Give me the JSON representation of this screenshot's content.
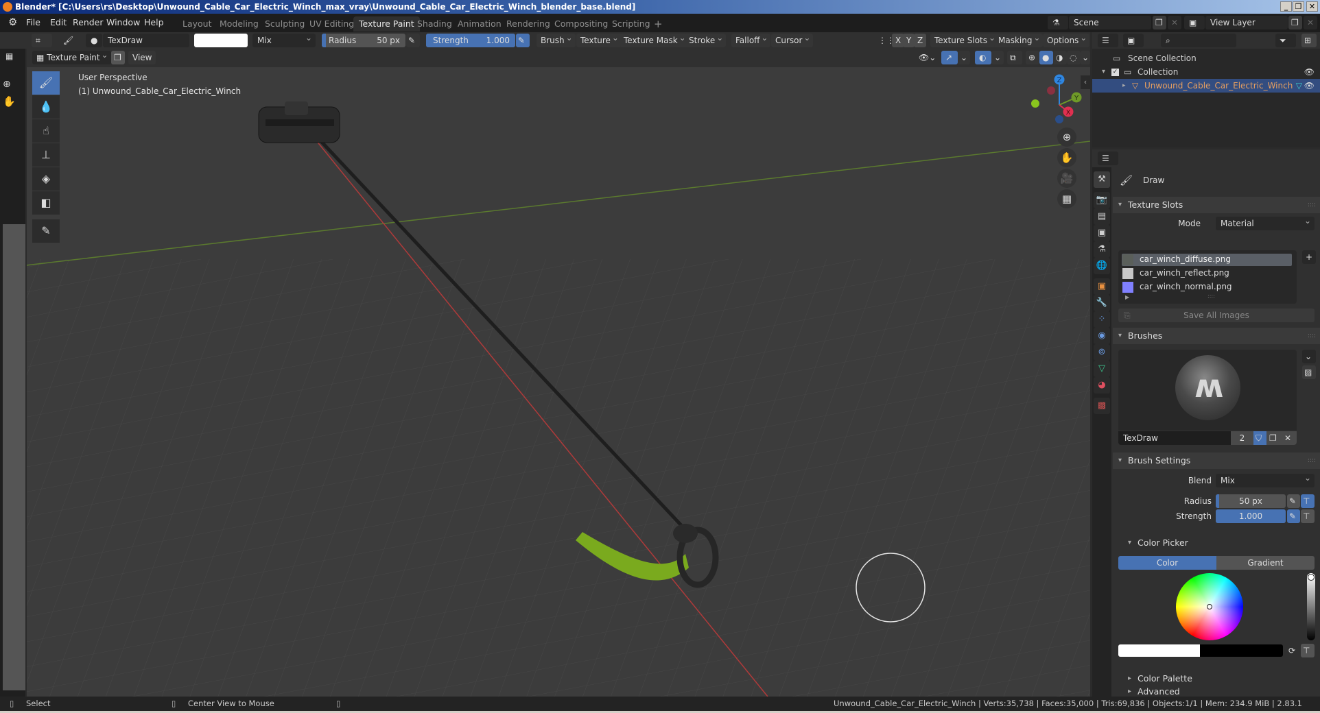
{
  "window": {
    "title": "Blender* [C:\\Users\\rs\\Desktop\\Unwound_Cable_Car_Electric_Winch_max_vray\\Unwound_Cable_Car_Electric_Winch_blender_base.blend]",
    "minimize": "_",
    "maximize": "❐",
    "close": "✕"
  },
  "menubar": {
    "items": [
      "File",
      "Edit",
      "Render",
      "Window",
      "Help"
    ],
    "workspaces": [
      "Layout",
      "Modeling",
      "Sculpting",
      "UV Editing",
      "Texture Paint",
      "Shading",
      "Animation",
      "Rendering",
      "Compositing",
      "Scripting"
    ],
    "active_workspace": "Texture Paint",
    "add_workspace": "+",
    "scene": "Scene",
    "view_layer": "View Layer"
  },
  "toolheader": {
    "brush_name": "TexDraw",
    "color_hex": "#ffffff",
    "blend": "Mix",
    "radius_label": "Radius",
    "radius_value": "50 px",
    "radius_fraction": 0.05,
    "strength_label": "Strength",
    "strength_value": "1.000",
    "strength_fraction": 1.0,
    "menus": [
      "Brush",
      "Texture",
      "Texture Mask",
      "Stroke",
      "Falloff",
      "Cursor"
    ],
    "axes": [
      "X",
      "Y",
      "Z"
    ],
    "right_menus": [
      "Texture Slots",
      "Masking",
      "Options"
    ]
  },
  "viewport_header": {
    "mode": "Texture Paint",
    "view": "View"
  },
  "viewport": {
    "perspective": "User Perspective",
    "object": "(1) Unwound_Cable_Car_Electric_Winch",
    "tools": [
      "draw-brush",
      "soften",
      "smear",
      "clone",
      "fill",
      "mask",
      "annotate"
    ],
    "gizmo": {
      "x": "X",
      "y": "Y",
      "z": "Z"
    }
  },
  "outliner": {
    "scene_collection": "Scene Collection",
    "collection": "Collection",
    "object": "Unwound_Cable_Car_Electric_Winch",
    "accent_object_color": "#e8a060"
  },
  "properties": {
    "tool_name": "Draw",
    "texture_slots": {
      "title": "Texture Slots",
      "mode_label": "Mode",
      "mode_value": "Material",
      "slots": [
        {
          "name": "car_winch_diffuse.png",
          "selected": true,
          "swatch": "#5a5f5a"
        },
        {
          "name": "car_winch_reflect.png",
          "selected": false,
          "swatch": "#c8c8c8"
        },
        {
          "name": "car_winch_normal.png",
          "selected": false,
          "swatch": "#8080ff"
        }
      ],
      "save_all": "Save All Images"
    },
    "brushes": {
      "title": "Brushes",
      "brush_name": "TexDraw",
      "users": "2"
    },
    "brush_settings": {
      "title": "Brush Settings",
      "blend_label": "Blend",
      "blend_value": "Mix",
      "radius_label": "Radius",
      "radius_value": "50 px",
      "strength_label": "Strength",
      "strength_value": "1.000"
    },
    "color_picker": {
      "title": "Color Picker",
      "tab_color": "Color",
      "tab_gradient": "Gradient",
      "primary_hex": "#ffffff",
      "secondary_hex": "#000000"
    },
    "color_palette": "Color Palette",
    "advanced": "Advanced"
  },
  "statusbar": {
    "left_action": "Select",
    "middle_action": "Center View to Mouse",
    "stats": "Unwound_Cable_Car_Electric_Winch | Verts:35,738 | Faces:35,000 | Tris:69,836 | Objects:1/1 | Mem: 234.9 MiB | 2.83.1"
  }
}
